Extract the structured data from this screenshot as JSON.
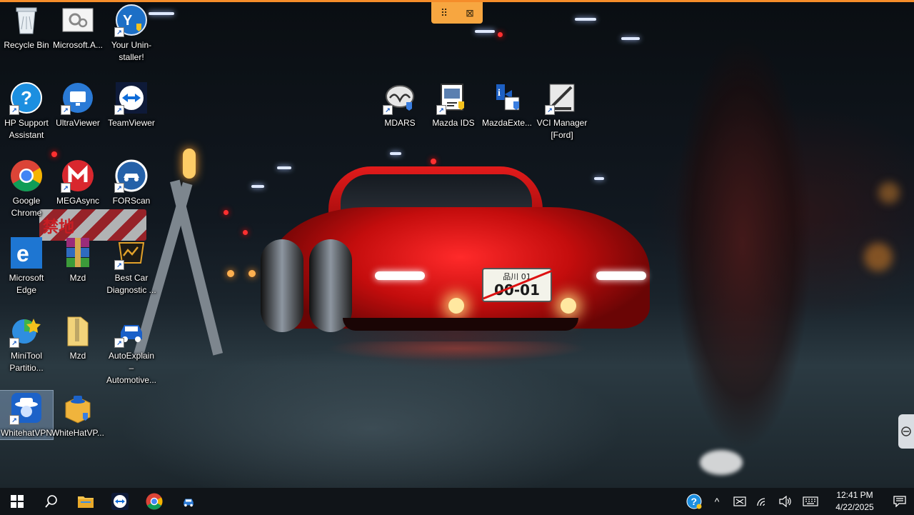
{
  "desktop": {
    "icons": [
      {
        "label": "Recycle Bin",
        "icon": "recycle-bin-icon"
      },
      {
        "label": "Microsoft.A...",
        "icon": "settings-file-icon"
      },
      {
        "label": "Your Unin-staller!",
        "icon": "your-uninstaller-icon"
      },
      {
        "label": "HP Support Assistant",
        "icon": "hp-support-icon"
      },
      {
        "label": "UltraViewer",
        "icon": "ultraviewer-icon"
      },
      {
        "label": "TeamViewer",
        "icon": "teamviewer-icon"
      },
      {
        "label": "Google Chrome",
        "icon": "chrome-icon"
      },
      {
        "label": "MEGAsync",
        "icon": "megasync-icon"
      },
      {
        "label": "FORScan",
        "icon": "forscan-icon"
      },
      {
        "label": "Microsoft Edge",
        "icon": "edge-icon"
      },
      {
        "label": "Mzd",
        "icon": "winrar-archive-icon"
      },
      {
        "label": "Best Car Diagnostic ...",
        "icon": "car-diagnostic-icon"
      },
      {
        "label": "MiniTool Partitio...",
        "icon": "minitool-icon"
      },
      {
        "label": "Mzd",
        "icon": "folder-archive-icon"
      },
      {
        "label": "AutoExplain – Automotive...",
        "icon": "autoexplain-icon"
      },
      {
        "label": "WhitehatVPN",
        "icon": "whitehatvpn-icon"
      },
      {
        "label": "WhiteHatVP...",
        "icon": "whitehatvpn-installer-icon"
      },
      {
        "label": "MDARS",
        "icon": "mazda-logo-icon"
      },
      {
        "label": "Mazda IDS",
        "icon": "mazda-ids-icon"
      },
      {
        "label": "MazdaExte...",
        "icon": "mazda-ext-icon"
      },
      {
        "label": "VCI Manager [Ford]",
        "icon": "vci-manager-icon"
      }
    ]
  },
  "wallpaper": {
    "plate_top": "品川 01",
    "plate_main": "00-01",
    "sign_text": "禁地"
  },
  "floating_toolbar": {
    "drag_symbol": "⠿",
    "close_symbol": "⊠"
  },
  "taskbar": {
    "apps": [
      "start-button",
      "search-button",
      "file-explorer",
      "teamviewer",
      "chrome",
      "autoexplain"
    ],
    "tray": {
      "chevron": "^",
      "time": "12:41 PM",
      "date": "4/22/2025"
    }
  },
  "colors": {
    "accent_bar": "#f58d2a",
    "taskbar": "#101418",
    "car_red": "#e21b1b"
  }
}
